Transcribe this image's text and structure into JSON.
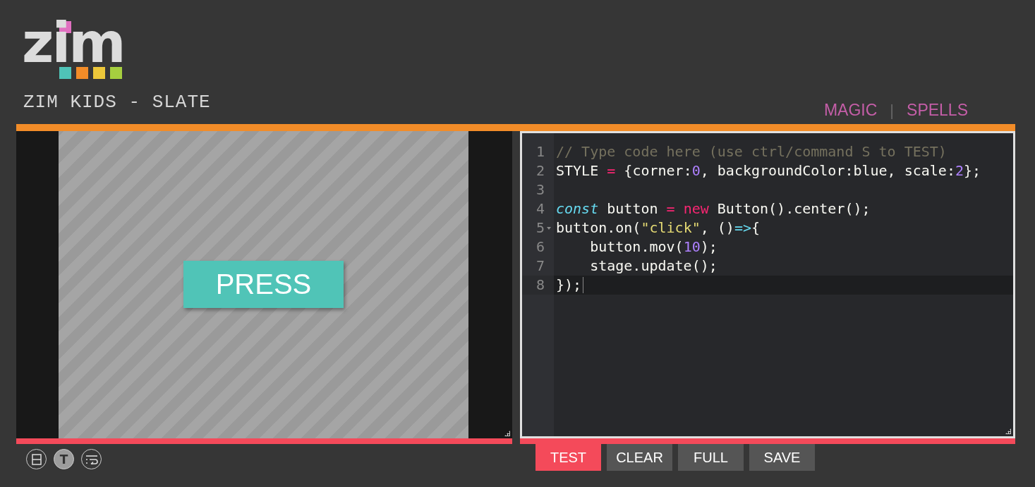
{
  "logo": {
    "text": "zim"
  },
  "title": "ZIM KIDS - SLATE",
  "nav": {
    "links": [
      "MAGIC",
      "SPELLS"
    ],
    "separator": "|"
  },
  "stage": {
    "button_label": "PRESS"
  },
  "editor": {
    "lines": [
      {
        "number": "1",
        "fold": false,
        "active": false,
        "tokens": [
          {
            "kind": "comment",
            "text": "// Type code here (use ctrl/command S to TEST)"
          }
        ]
      },
      {
        "number": "2",
        "fold": false,
        "active": false,
        "tokens": [
          {
            "kind": "plain",
            "text": "STYLE "
          },
          {
            "kind": "operator",
            "text": "="
          },
          {
            "kind": "plain",
            "text": " {corner:"
          },
          {
            "kind": "number",
            "text": "0"
          },
          {
            "kind": "plain",
            "text": ", backgroundColor:blue, scale:"
          },
          {
            "kind": "number",
            "text": "2"
          },
          {
            "kind": "plain",
            "text": "};"
          }
        ]
      },
      {
        "number": "3",
        "fold": false,
        "active": false
      },
      {
        "number": "4",
        "fold": false,
        "active": false,
        "tokens": [
          {
            "kind": "storage",
            "text": "const"
          },
          {
            "kind": "plain",
            "text": " button "
          },
          {
            "kind": "operator",
            "text": "= new"
          },
          {
            "kind": "plain",
            "text": " Button().center();"
          }
        ]
      },
      {
        "number": "5",
        "fold": true,
        "active": false,
        "tokens": [
          {
            "kind": "plain",
            "text": "button.on("
          },
          {
            "kind": "string",
            "text": "\"click\""
          },
          {
            "kind": "plain",
            "text": ", ()"
          },
          {
            "kind": "arrow",
            "text": "=>"
          },
          {
            "kind": "plain",
            "text": "{"
          }
        ]
      },
      {
        "number": "6",
        "fold": false,
        "active": false,
        "tokens": [
          {
            "kind": "plain",
            "text": "    button.mov("
          },
          {
            "kind": "number",
            "text": "10"
          },
          {
            "kind": "plain",
            "text": ");"
          }
        ]
      },
      {
        "number": "7",
        "fold": false,
        "active": false,
        "tokens": [
          {
            "kind": "plain",
            "text": "    stage.update();"
          }
        ]
      },
      {
        "number": "8",
        "fold": false,
        "active": true,
        "tokens": [
          {
            "kind": "plain",
            "text": "});"
          }
        ]
      }
    ]
  },
  "tools": [
    {
      "kind": "split",
      "selected": false
    },
    {
      "kind": "text",
      "label": "T",
      "selected": true
    },
    {
      "kind": "wrap",
      "selected": false
    }
  ],
  "actions": [
    {
      "label": "TEST",
      "selected": true
    },
    {
      "label": "CLEAR",
      "selected": false
    },
    {
      "label": "FULL",
      "selected": false
    },
    {
      "label": "SAVE",
      "selected": false
    }
  ]
}
